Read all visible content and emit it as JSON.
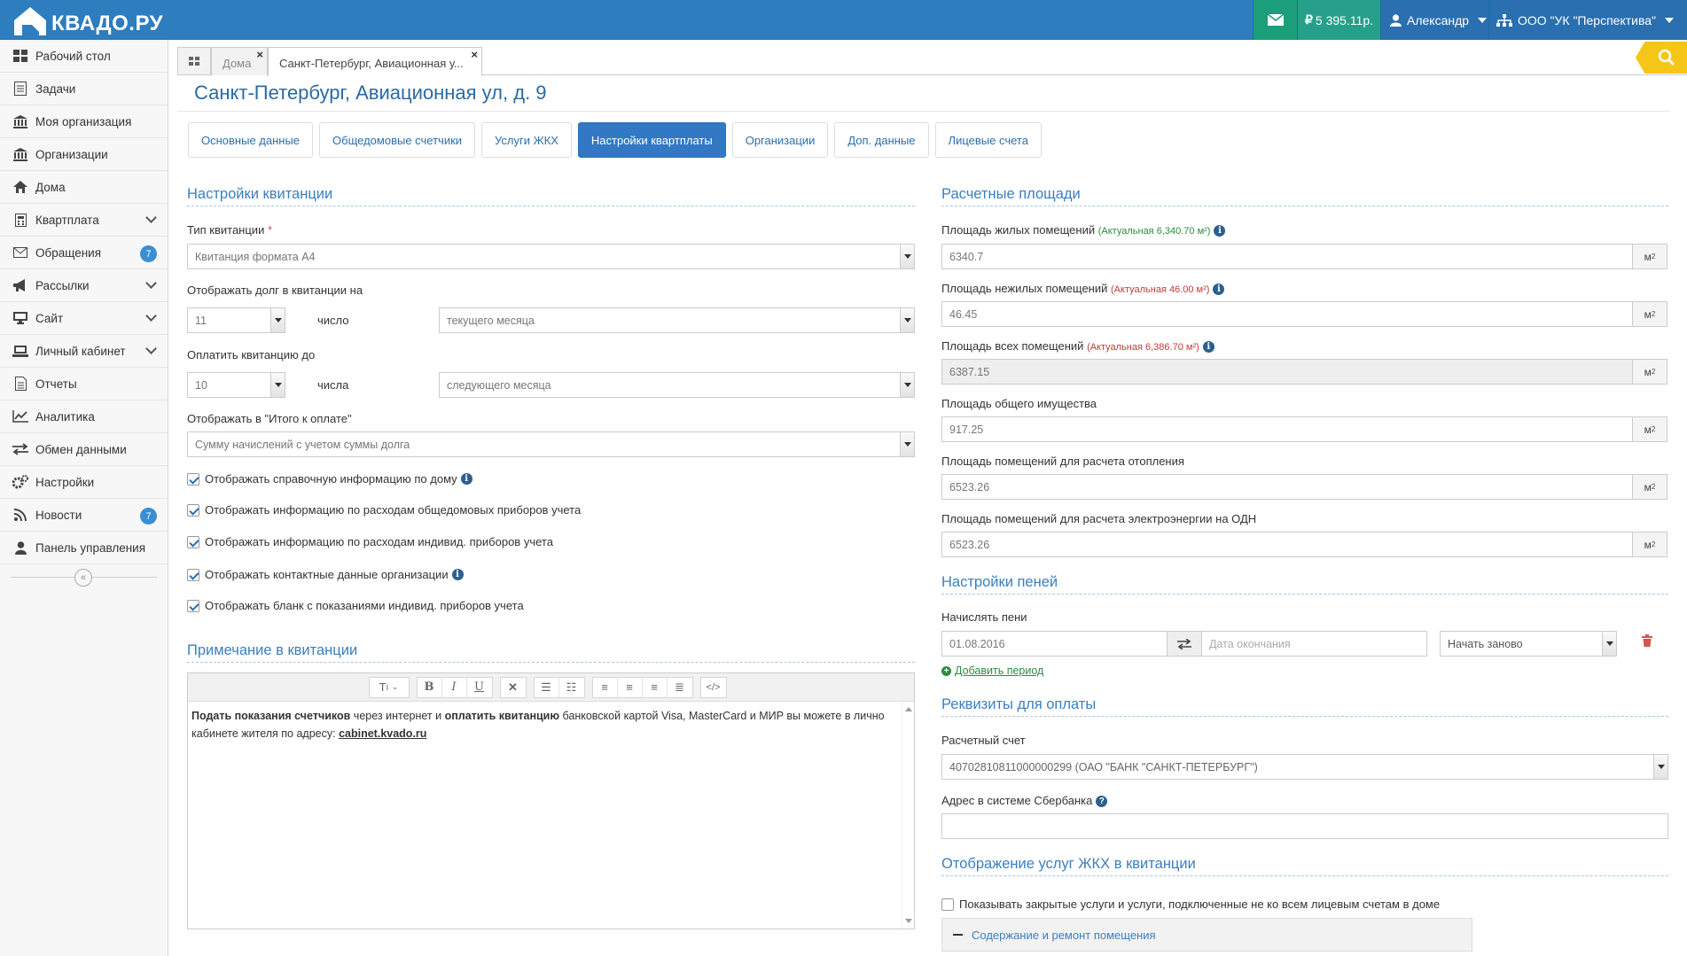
{
  "app": {
    "logo": "КВАДО.РУ"
  },
  "topbar": {
    "balance": "5 395.11р.",
    "user": "Александр",
    "org": "ООО \"УК \"Перспектива\""
  },
  "sidebar": {
    "items": [
      {
        "label": "Рабочий стол",
        "icon": "dashboard-icon"
      },
      {
        "label": "Задачи",
        "icon": "tasks-icon"
      },
      {
        "label": "Моя организация",
        "icon": "bank-icon"
      },
      {
        "label": "Организации",
        "icon": "bank-icon"
      },
      {
        "label": "Дома",
        "icon": "home-icon"
      },
      {
        "label": "Квартплата",
        "icon": "calculator-icon",
        "expand": true
      },
      {
        "label": "Обращения",
        "icon": "envelope-icon",
        "badge": "7"
      },
      {
        "label": "Рассылки",
        "icon": "megaphone-icon",
        "expand": true
      },
      {
        "label": "Сайт",
        "icon": "monitor-icon",
        "expand": true
      },
      {
        "label": "Личный кабинет",
        "icon": "laptop-icon",
        "expand": true
      },
      {
        "label": "Отчеты",
        "icon": "report-icon"
      },
      {
        "label": "Аналитика",
        "icon": "chart-icon"
      },
      {
        "label": "Обмен данными",
        "icon": "exchange-icon"
      },
      {
        "label": "Настройки",
        "icon": "gears-icon"
      },
      {
        "label": "Новости",
        "icon": "rss-icon",
        "badge": "7"
      },
      {
        "label": "Панель управления",
        "icon": "user-icon"
      }
    ],
    "collapse": "«"
  },
  "tabs": [
    {
      "label": "Дома"
    },
    {
      "label": "Санкт-Петербург, Авиационная у..."
    }
  ],
  "page": {
    "title": "Санкт-Петербург, Авиационная ул, д. 9"
  },
  "subtabs": [
    "Основные данные",
    "Общедомовые счетчики",
    "Услуги ЖКХ",
    "Настройки квартплаты",
    "Организации",
    "Доп. данные",
    "Лицевые счета"
  ],
  "receipt": {
    "title": "Настройки квитанции",
    "type_label": "Тип квитанции",
    "type_value": "Квитанция формата А4",
    "debt_label": "Отображать долг в квитанции на",
    "debt_day": "11",
    "debt_word": "число",
    "debt_month": "текущего месяца",
    "pay_label": "Оплатить квитанцию до",
    "pay_day": "10",
    "pay_word": "числа",
    "pay_month": "следующего месяца",
    "total_label": "Отображать в \"Итого к оплате\"",
    "total_value": "Сумму начислений с учетом суммы долга",
    "checks": [
      "Отображать справочную информацию по дому",
      "Отображать информацию по расходам общедомовых приборов учета",
      "Отображать информацию по расходам индивид. приборов учета",
      "Отображать контактные данные организации",
      "Отображать бланк с показаниями индивид. приборов учета"
    ]
  },
  "note": {
    "title": "Примечание в квитанции",
    "b1": "Подать показания счетчиков",
    "t1": " через интернет и ",
    "b2": "оплатить квитанцию",
    "t2": " банковской картой Visa, MasterCard и МИР вы можете в лично кабинете жителя по адресу: ",
    "link": "cabinet.kvado.ru"
  },
  "areas": {
    "title": "Расчетные площади",
    "unit": "м",
    "living_label": "Площадь жилых помещений",
    "living_hint": "(Актуальная 6,340.70 м²)",
    "living_value": "6340.7",
    "nonliving_label": "Площадь нежилых помещений",
    "nonliving_hint": "(Актуальная 46.00 м²)",
    "nonliving_value": "46.45",
    "all_label": "Площадь всех помещений",
    "all_hint": "(Актуальная 6,386.70 м²)",
    "all_value": "6387.15",
    "common_label": "Площадь общего имущества",
    "common_value": "917.25",
    "heating_label": "Площадь помещений для расчета отопления",
    "heating_value": "6523.26",
    "electro_label": "Площадь помещений для расчета электроэнергии на ОДН",
    "electro_value": "6523.26"
  },
  "penalty": {
    "title": "Настройки пеней",
    "label": "Начислять пени",
    "start": "01.08.2016",
    "end_placeholder": "Дата окончания",
    "mode": "Начать заново",
    "add": "Добавить период"
  },
  "requisites": {
    "title": "Реквизиты для оплаты",
    "account_label": "Расчетный счет",
    "account_value": "40702810811000000299 (ОАО \"БАНК \"САНКТ-ПЕТЕРБУРГ\")",
    "sber_label": "Адрес в системе Сбербанка"
  },
  "services": {
    "title": "Отображение услуг ЖКХ в квитанции",
    "check": "Показывать закрытые услуги и услуги, подключенные не ко всем лицевым счетам в доме",
    "group": "Содержание и ремонт помещения"
  }
}
